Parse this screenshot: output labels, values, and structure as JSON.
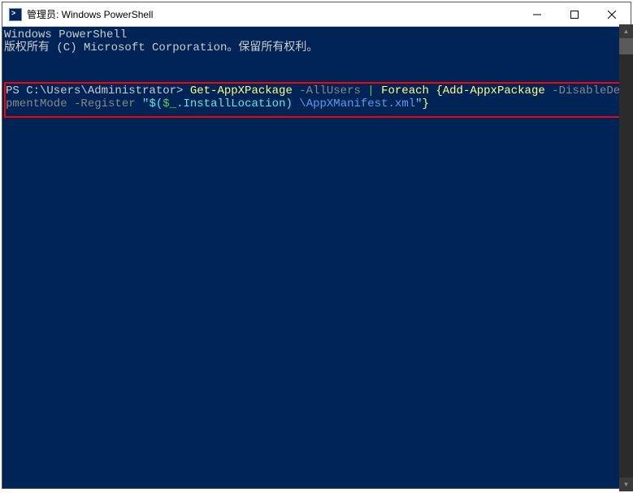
{
  "window": {
    "title": "管理员: Windows PowerShell"
  },
  "terminal": {
    "header_line1": "Windows PowerShell",
    "header_line2": "版权所有 (C) Microsoft Corporation。保留所有权利。",
    "prompt": "PS C:\\Users\\Administrator> ",
    "cmd_part1": "Get-AppXPackage",
    "cmd_part2": " -AllUsers ",
    "cmd_pipe": "|",
    "cmd_part3": " Foreach ",
    "cmd_brace_open": "{",
    "cmd_part4": "Add-AppxPackage",
    "cmd_part5": " -DisableDevelo",
    "cmd_line2_part1": "pmentMode ",
    "cmd_line2_part2": "-Register ",
    "cmd_quote_open": "\"",
    "cmd_line2_part3": "$(",
    "cmd_var": "$_",
    "cmd_line2_part4": ".InstallLocation)",
    "cmd_line2_part5": " \\AppXManifest.xml",
    "cmd_quote_close": "\"",
    "cmd_brace_close": "}"
  }
}
